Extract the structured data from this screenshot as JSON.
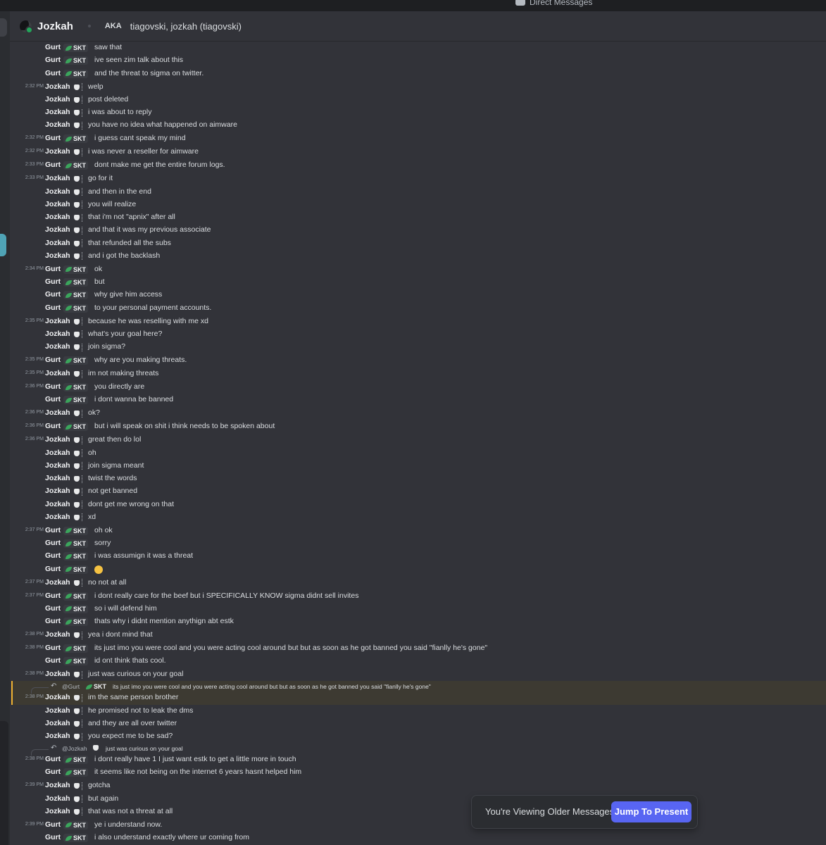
{
  "top_bar": {
    "direct_messages": "Direct Messages"
  },
  "header": {
    "name": "Jozkah",
    "aka_label": "AKA",
    "aka_names": "tiagovski, jozkah (tiagovski)"
  },
  "users": {
    "gurt": {
      "name": "Gurt",
      "tag": "SKT"
    },
    "jozkah": {
      "name": "Jozkah"
    }
  },
  "messages": [
    {
      "u": "g",
      "ts": "",
      "text": "saw that"
    },
    {
      "u": "g",
      "ts": "",
      "text": "ive seen zim talk about this"
    },
    {
      "u": "g",
      "ts": "",
      "text": "and the threat to sigma on twitter."
    },
    {
      "u": "j",
      "ts": "2:32 PM",
      "text": "welp"
    },
    {
      "u": "j",
      "ts": "",
      "text": "post deleted"
    },
    {
      "u": "j",
      "ts": "",
      "text": "i was about to reply"
    },
    {
      "u": "j",
      "ts": "",
      "text": "you have no idea what happened on aimware"
    },
    {
      "u": "g",
      "ts": "2:32 PM",
      "text": "i guess cant speak my mind"
    },
    {
      "u": "j",
      "ts": "2:32 PM",
      "text": "i was never a reseller for aimware"
    },
    {
      "u": "g",
      "ts": "2:33 PM",
      "text": "dont make me get the entire forum logs."
    },
    {
      "u": "j",
      "ts": "2:33 PM",
      "text": "go for it"
    },
    {
      "u": "j",
      "ts": "",
      "text": "and then in the end"
    },
    {
      "u": "j",
      "ts": "",
      "text": "you will realize"
    },
    {
      "u": "j",
      "ts": "",
      "text": "that i'm not \"apnix\" after all"
    },
    {
      "u": "j",
      "ts": "",
      "text": "and that it was my previous associate"
    },
    {
      "u": "j",
      "ts": "",
      "text": "that refunded all the subs"
    },
    {
      "u": "j",
      "ts": "",
      "text": "and i got the backlash"
    },
    {
      "u": "g",
      "ts": "2:34 PM",
      "text": "ok"
    },
    {
      "u": "g",
      "ts": "",
      "text": "but"
    },
    {
      "u": "g",
      "ts": "",
      "text": "why give him access"
    },
    {
      "u": "g",
      "ts": "",
      "text": "to your personal payment accounts."
    },
    {
      "u": "j",
      "ts": "2:35 PM",
      "text": "because he was reselling with me xd"
    },
    {
      "u": "j",
      "ts": "",
      "text": "what's your goal here?"
    },
    {
      "u": "j",
      "ts": "",
      "text": "join sigma?"
    },
    {
      "u": "g",
      "ts": "2:35 PM",
      "text": "why are you making threats."
    },
    {
      "u": "j",
      "ts": "2:35 PM",
      "text": "im not making threats"
    },
    {
      "u": "g",
      "ts": "2:36 PM",
      "text": "you directly are"
    },
    {
      "u": "g",
      "ts": "",
      "text": "i dont wanna be banned"
    },
    {
      "u": "j",
      "ts": "2:36 PM",
      "text": "ok?"
    },
    {
      "u": "g",
      "ts": "2:36 PM",
      "text": "but i will speak on shit i think needs to be spoken about"
    },
    {
      "u": "j",
      "ts": "2:36 PM",
      "text": "great then do lol"
    },
    {
      "u": "j",
      "ts": "",
      "text": "oh"
    },
    {
      "u": "j",
      "ts": "",
      "text": "join sigma meant"
    },
    {
      "u": "j",
      "ts": "",
      "text": "twist the words"
    },
    {
      "u": "j",
      "ts": "",
      "text": "not get banned"
    },
    {
      "u": "j",
      "ts": "",
      "text": "dont get me wrong on that"
    },
    {
      "u": "j",
      "ts": "",
      "text": "xd"
    },
    {
      "u": "g",
      "ts": "2:37 PM",
      "text": "oh ok"
    },
    {
      "u": "g",
      "ts": "",
      "text": "sorry"
    },
    {
      "u": "g",
      "ts": "",
      "text": "i was assumign it was a threat"
    },
    {
      "u": "g",
      "ts": "",
      "text": "",
      "emoji": "sob-emoji"
    },
    {
      "u": "j",
      "ts": "2:37 PM",
      "text": "no not at all"
    },
    {
      "u": "g",
      "ts": "2:37 PM",
      "text": "i dont really care for the beef but i SPECIFICALLY KNOW sigma didnt sell invites"
    },
    {
      "u": "g",
      "ts": "",
      "text": "so i will defend him"
    },
    {
      "u": "g",
      "ts": "",
      "text": "thats why i didnt mention anythign abt estk"
    },
    {
      "u": "j",
      "ts": "2:38 PM",
      "text": "yea i dont mind that"
    },
    {
      "u": "g",
      "ts": "2:38 PM",
      "text": "its just imo you were cool and you were acting cool around but but as soon as he got banned you said \"fianlly he's gone\""
    },
    {
      "u": "g",
      "ts": "",
      "text": "id ont think thats cool."
    },
    {
      "u": "j",
      "ts": "2:38 PM",
      "text": "just was curious on your goal"
    },
    {
      "u": "j",
      "ts": "2:38 PM",
      "text": "im the same person brother",
      "reply": {
        "to": "@Gurt",
        "tag": "SKT",
        "text": "its just imo you were cool and you were acting cool around but but as soon as he got banned you said \"fianlly he's gone\""
      }
    },
    {
      "u": "j",
      "ts": "",
      "text": "he promised not to leak the dms"
    },
    {
      "u": "j",
      "ts": "",
      "text": "and they are all over twitter"
    },
    {
      "u": "j",
      "ts": "",
      "text": "you expect me to be sad?"
    },
    {
      "u": "g",
      "ts": "2:38 PM",
      "text": "i dont really have 1 I just want estk to get a little more in touch",
      "reply": {
        "to": "@Jozkah",
        "tag": "",
        "text": "just was curious on your goal"
      }
    },
    {
      "u": "g",
      "ts": "",
      "text": "it seems like not being on the internet 6 years hasnt helped him"
    },
    {
      "u": "j",
      "ts": "2:39 PM",
      "text": "gotcha"
    },
    {
      "u": "j",
      "ts": "",
      "text": "but again"
    },
    {
      "u": "j",
      "ts": "",
      "text": "that was not a threat at all"
    },
    {
      "u": "g",
      "ts": "2:39 PM",
      "text": "ye i understand now."
    },
    {
      "u": "g",
      "ts": "",
      "text": "i also understand exactly where ur coming from"
    }
  ],
  "banner": {
    "text": "You're Viewing Older Messages",
    "button": "Jump To Present"
  },
  "colors": {
    "background": "#323339",
    "accent": "#5865f2",
    "leaf": "#3ba55c",
    "highlight_border": "#f0b232"
  }
}
